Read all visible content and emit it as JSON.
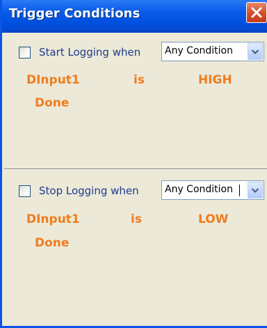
{
  "window": {
    "title": "Trigger Conditions",
    "close_icon": "close-x-icon"
  },
  "colors": {
    "titlebar": "#0a5ce8",
    "background": "#ece9d8",
    "condition_text": "#f07d1e",
    "label_text": "#1f3c8c",
    "close_button": "#d4512c"
  },
  "start": {
    "checkbox_checked": false,
    "label": "Start Logging when",
    "select_value": "Any Condition",
    "select_icon": "chevron-down-icon",
    "condition": {
      "input": "DInput1",
      "operator": "is",
      "state": "HIGH",
      "action": "Done"
    }
  },
  "stop": {
    "checkbox_checked": false,
    "label": "Stop Logging when",
    "select_value": "Any Condition",
    "select_icon": "chevron-down-icon",
    "condition": {
      "input": "DInput1",
      "operator": "is",
      "state": "LOW",
      "action": "Done"
    }
  }
}
